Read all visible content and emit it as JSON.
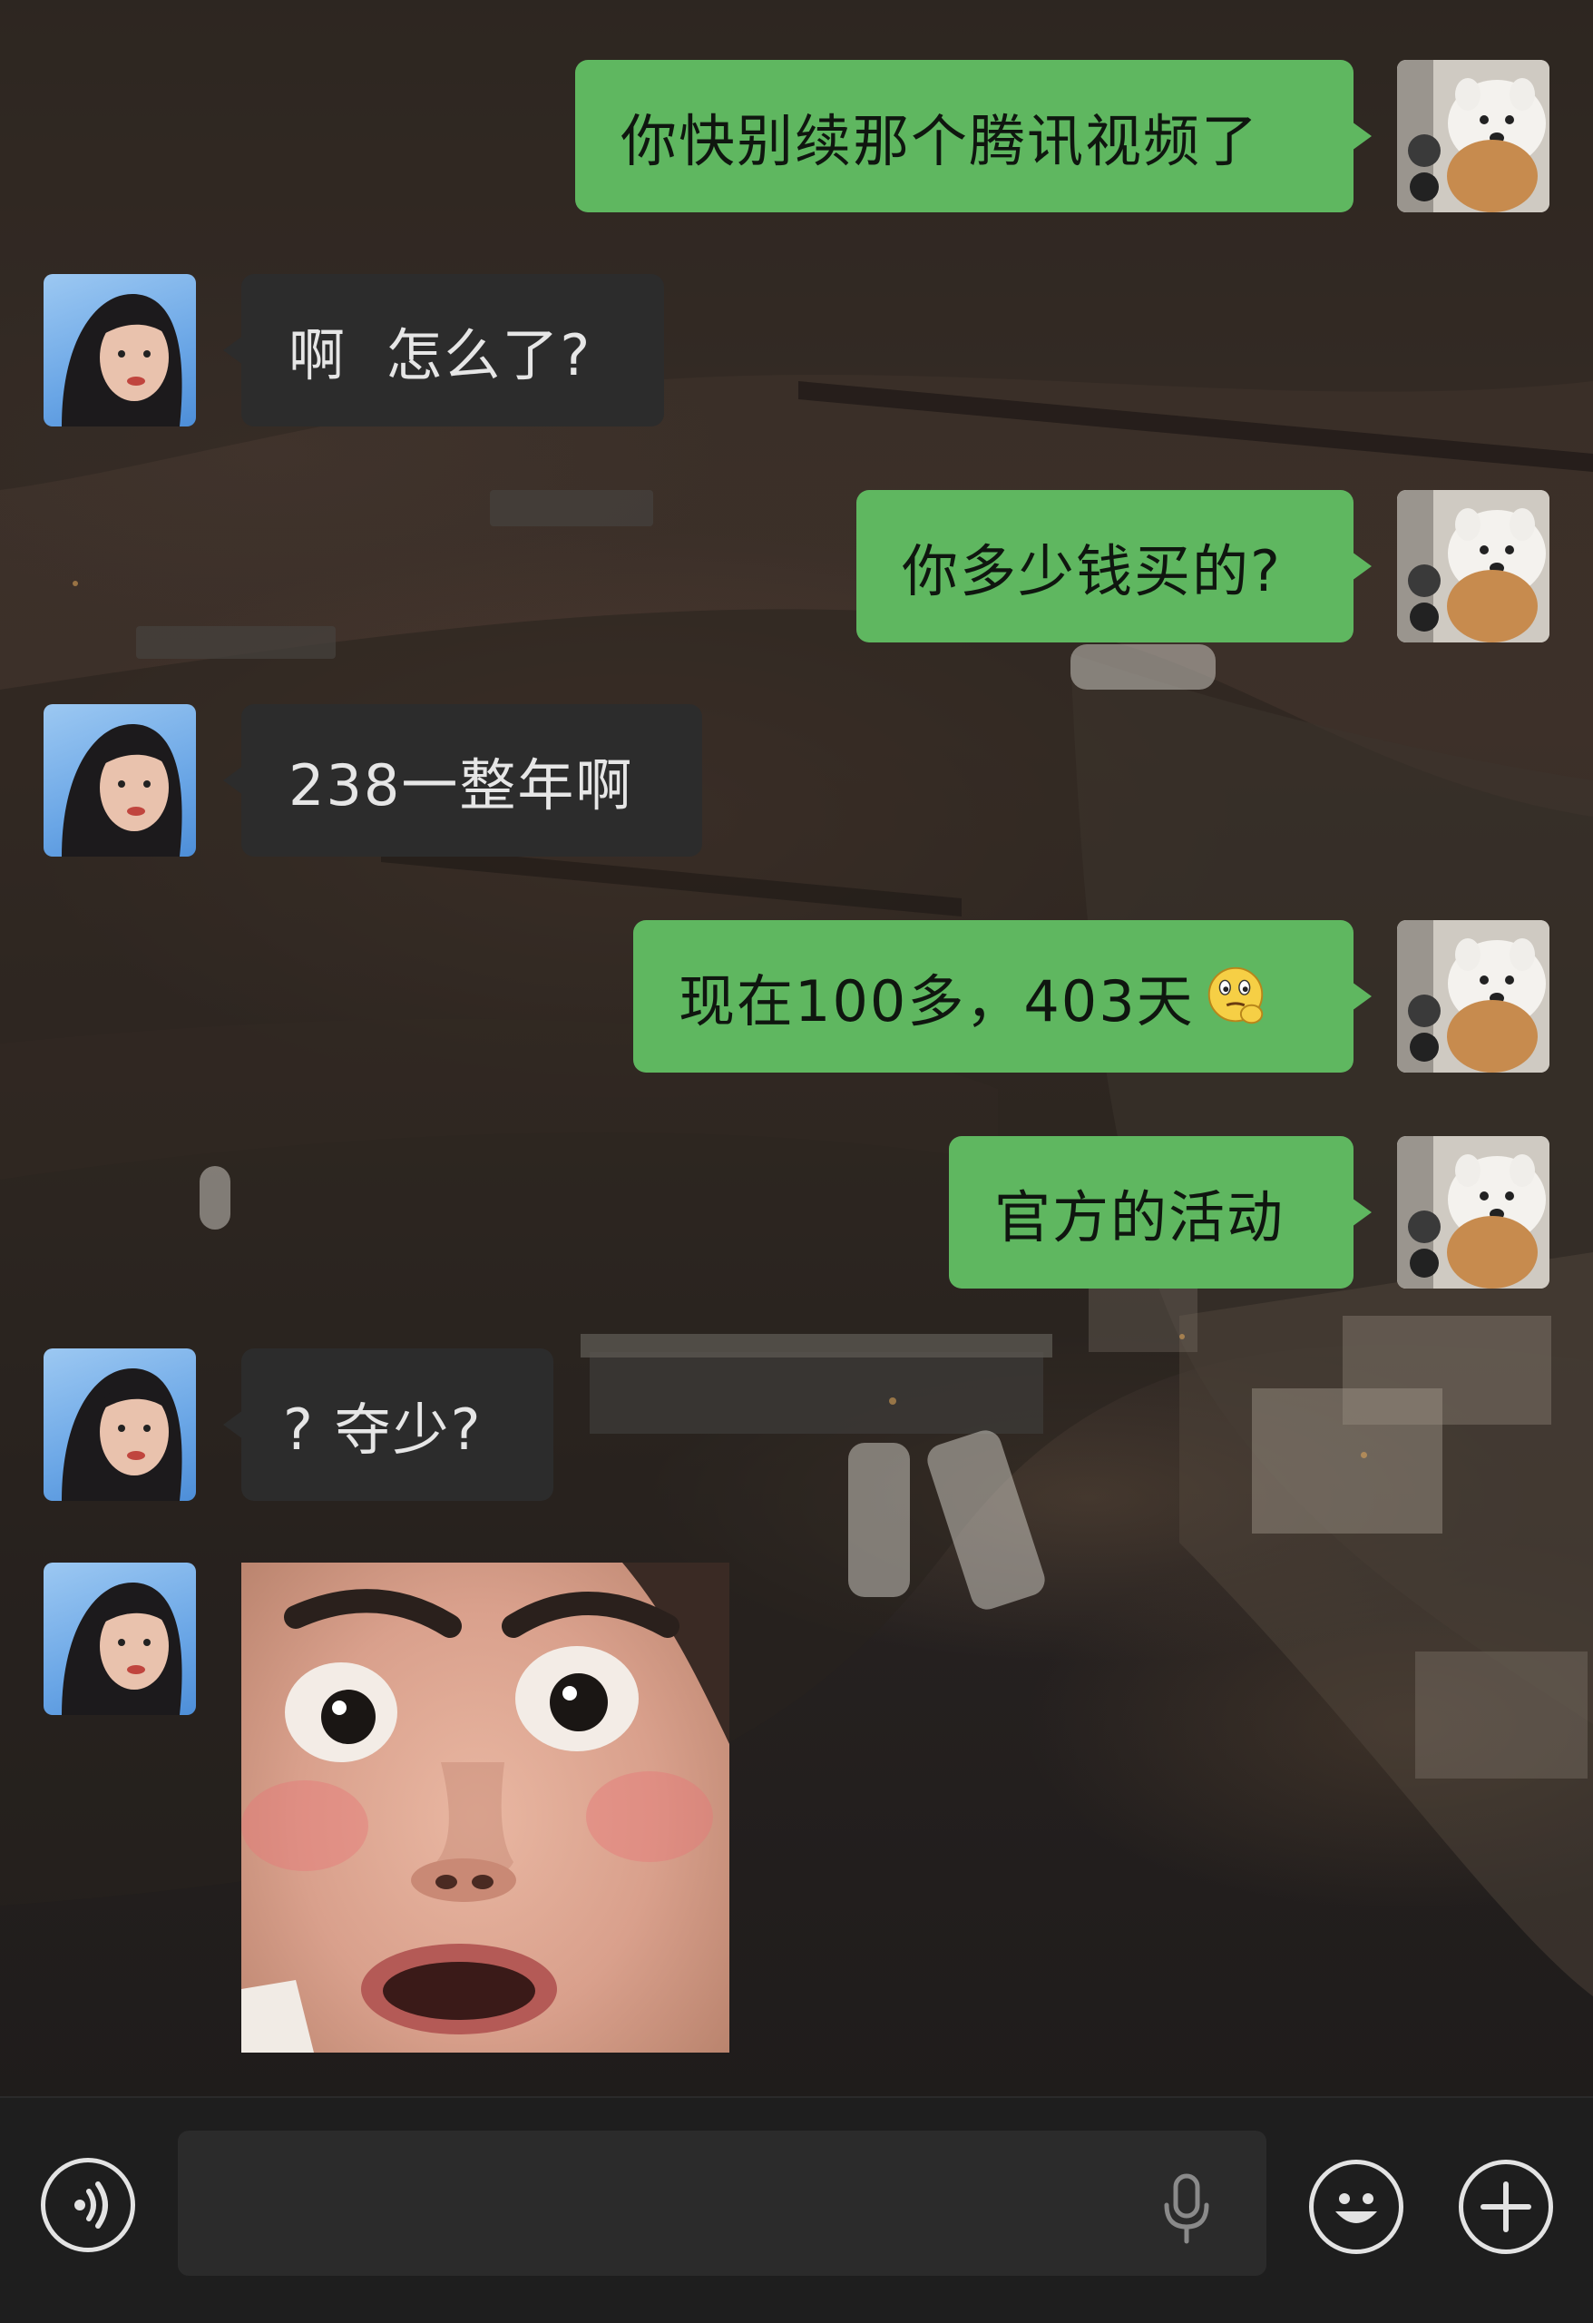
{
  "chat": {
    "messages": [
      {
        "side": "me",
        "text": "你快别续那个腾讯视频了"
      },
      {
        "side": "other",
        "text": "啊  怎么了?"
      },
      {
        "side": "me",
        "text": "你多少钱买的?"
      },
      {
        "side": "other",
        "text": "238一整年啊"
      },
      {
        "side": "me",
        "text": "现在100多，403天",
        "emoji": "thinking-face-emoji"
      },
      {
        "side": "me",
        "text": "官方的活动"
      },
      {
        "side": "other",
        "text": "? 夺少?"
      },
      {
        "side": "other",
        "type": "sticker",
        "sticker": "shocked-face-sticker"
      }
    ]
  },
  "input_bar": {
    "text_value": "",
    "icons": [
      "voice-mode-icon",
      "microphone-icon",
      "emoji-icon",
      "plus-icon"
    ]
  },
  "colors": {
    "my_bubble": "#5fb760",
    "other_bubble": "#2c2c2c",
    "input_bar_bg": "#1e1e1e"
  }
}
